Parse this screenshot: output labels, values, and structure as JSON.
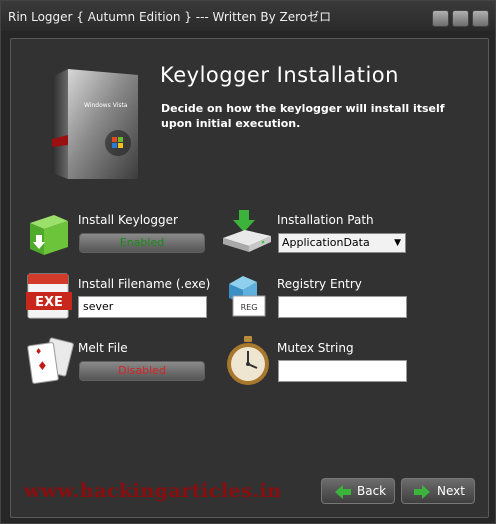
{
  "window": {
    "title": "Rin Logger  { Autumn Edition } --- Written By Zeroゼロ"
  },
  "header": {
    "heading": "Keylogger Installation",
    "description": "Decide on how the keylogger will install itself upon initial execution.",
    "box_text": "Windows Vista"
  },
  "options": {
    "install_keylogger": {
      "label": "Install Keylogger",
      "state": "Enabled"
    },
    "installation_path": {
      "label": "Installation Path",
      "value": "ApplicationData"
    },
    "install_filename": {
      "label": "Install Filename (.exe)",
      "value": "sever",
      "icon_text": "EXE"
    },
    "registry_entry": {
      "label": "Registry Entry",
      "value": "",
      "icon_text": "REG"
    },
    "melt_file": {
      "label": "Melt File",
      "state": "Disabled"
    },
    "mutex_string": {
      "label": "Mutex String",
      "value": ""
    }
  },
  "footer": {
    "watermark": "www.hackingarticles.in",
    "back_label": "Back",
    "next_label": "Next"
  },
  "colors": {
    "enabled": "#1a8a1a",
    "disabled": "#d82222",
    "watermark": "#8b0d0d",
    "arrow_green": "#3cb43c"
  }
}
